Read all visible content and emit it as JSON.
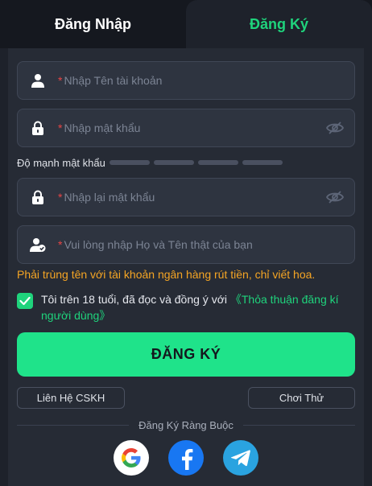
{
  "tabs": {
    "login": "Đăng Nhập",
    "register": "Đăng Ký"
  },
  "form": {
    "username": {
      "placeholder": "Nhập Tên tài khoản",
      "value": ""
    },
    "password": {
      "placeholder": "Nhập mật khẩu",
      "value": ""
    },
    "strength": {
      "label": "Độ mạnh mật khẩu",
      "segments": 4,
      "filled": 0
    },
    "confirm_password": {
      "placeholder": "Nhập lại mật khẩu",
      "value": ""
    },
    "full_name": {
      "placeholder": "Vui lòng nhập Họ và Tên thật của bạn",
      "value": ""
    },
    "required_mark": "*",
    "name_warning": "Phải trùng tên với tài khoản ngân hàng rút tiền, chỉ viết hoa.",
    "agreement": {
      "checked": true,
      "text": "Tôi trên 18 tuổi, đã đọc và đồng ý với ",
      "link": "《Thỏa thuận đăng kí người dùng》"
    },
    "submit_label": "ĐĂNG KÝ"
  },
  "secondary": {
    "support_label": "Liên Hệ CSKH",
    "try_label": "Chơi Thử"
  },
  "social": {
    "title": "Đăng Ký Ràng Buộc",
    "providers": [
      "google-icon",
      "facebook-icon",
      "telegram-icon"
    ]
  },
  "colors": {
    "accent": "#1fe38a",
    "warning": "#f5a524",
    "required": "#e84545",
    "background": "#1e222b"
  }
}
